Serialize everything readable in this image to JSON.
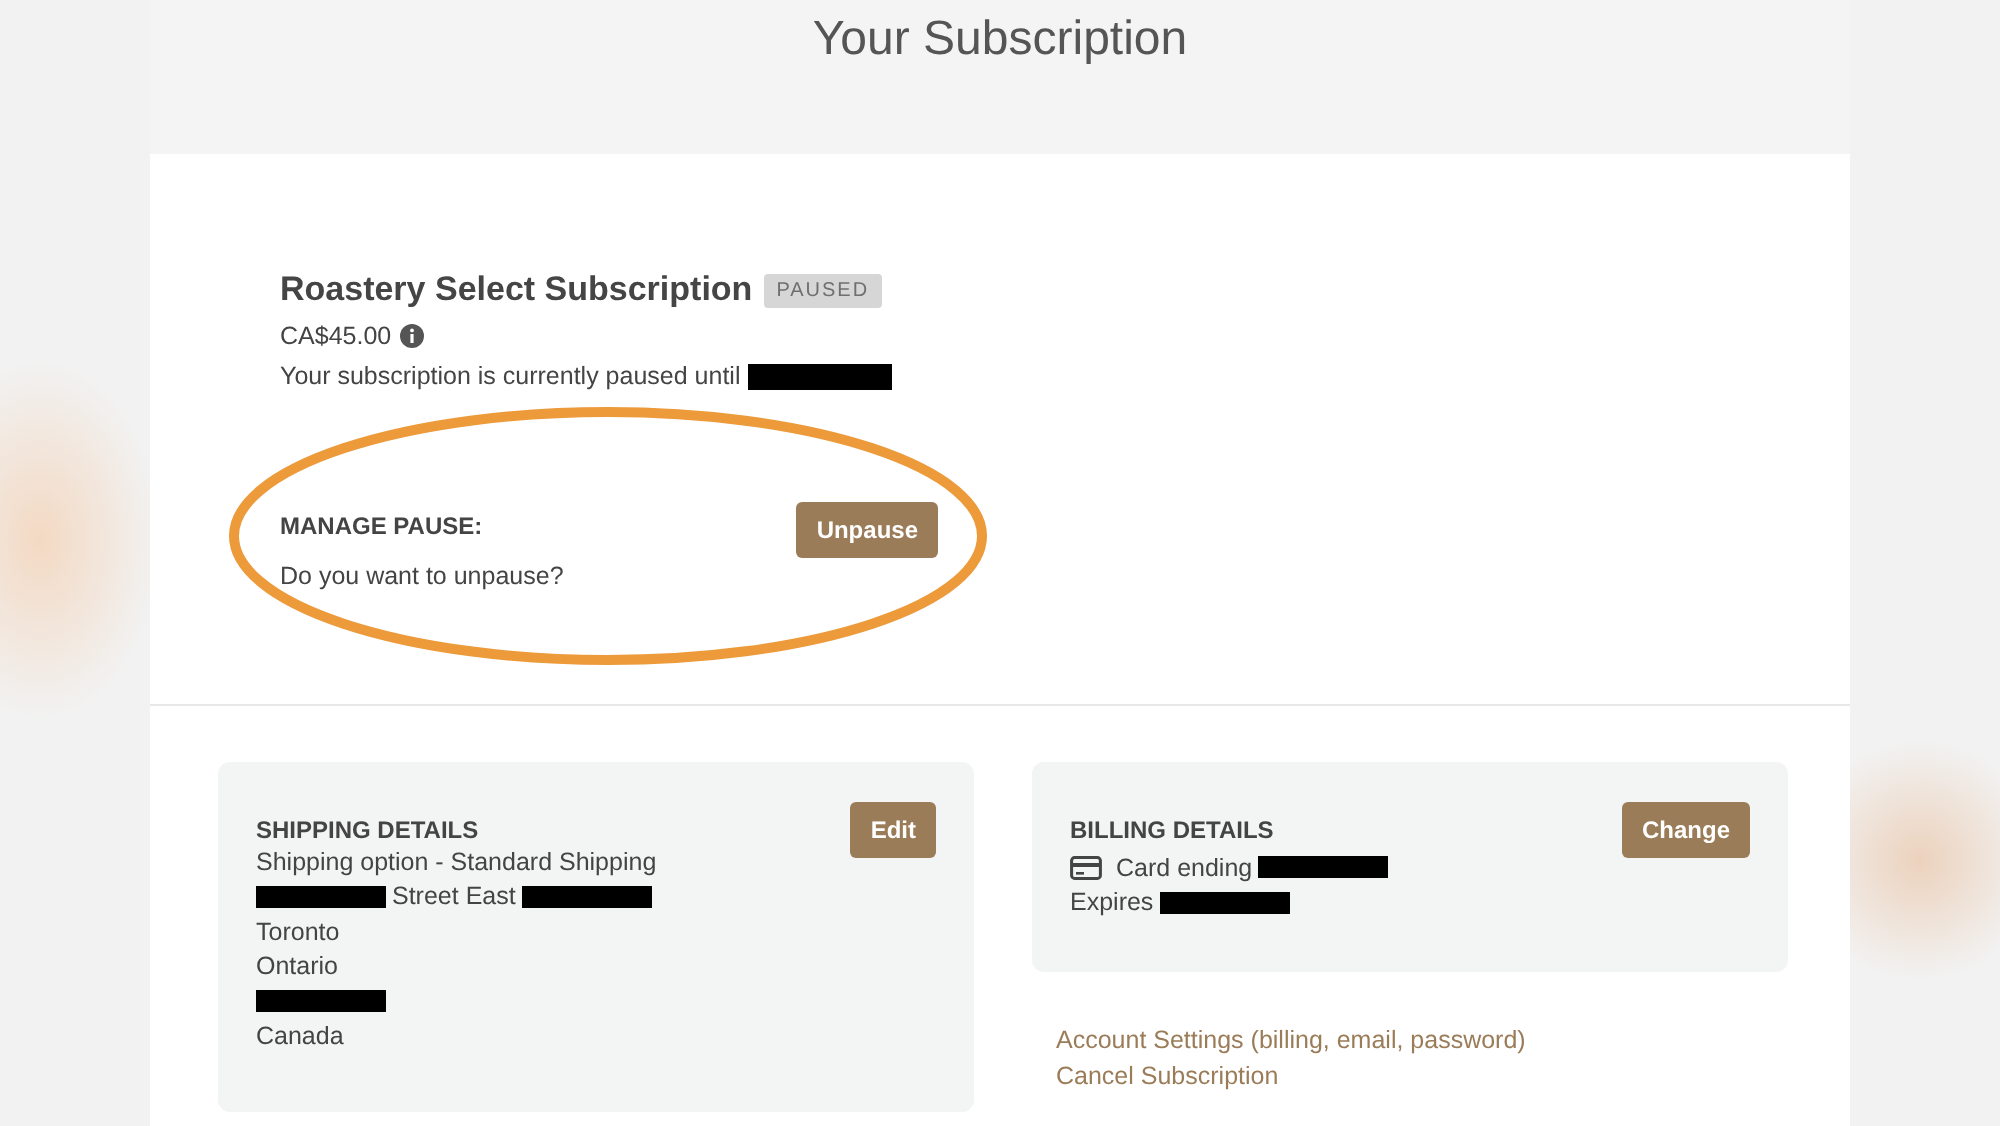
{
  "page_title": "Your Subscription",
  "subscription": {
    "name": "Roastery Select Subscription",
    "status": "PAUSED",
    "price": "CA$45.00",
    "pause_note": [
      {
        "kind": "text",
        "text": "Your subscription is currently paused until"
      },
      {
        "kind": "redacted"
      }
    ]
  },
  "manage_pause": {
    "label": "MANAGE PAUSE:",
    "question": "Do you want to unpause?",
    "button": "Unpause",
    "highlighted": true
  },
  "shipping": {
    "title": "SHIPPING DETAILS",
    "button": "Edit",
    "lines": [
      [
        {
          "kind": "text",
          "text": "Shipping option - Standard Shipping"
        }
      ],
      [
        {
          "kind": "redacted"
        },
        {
          "kind": "text",
          "text": "Street East"
        },
        {
          "kind": "redacted"
        }
      ],
      [
        {
          "kind": "text",
          "text": "Toronto"
        }
      ],
      [
        {
          "kind": "text",
          "text": "Ontario"
        }
      ],
      [
        {
          "kind": "redacted"
        }
      ],
      [
        {
          "kind": "text",
          "text": "Canada"
        }
      ]
    ]
  },
  "billing": {
    "title": "BILLING DETAILS",
    "button": "Change",
    "lines": [
      [
        {
          "kind": "card"
        },
        {
          "kind": "text",
          "text": "Card ending"
        },
        {
          "kind": "redacted"
        }
      ],
      [
        {
          "kind": "text",
          "text": "Expires"
        },
        {
          "kind": "redacted"
        }
      ]
    ]
  },
  "links": [
    "Account Settings (billing, email, password)",
    "Cancel Subscription"
  ]
}
